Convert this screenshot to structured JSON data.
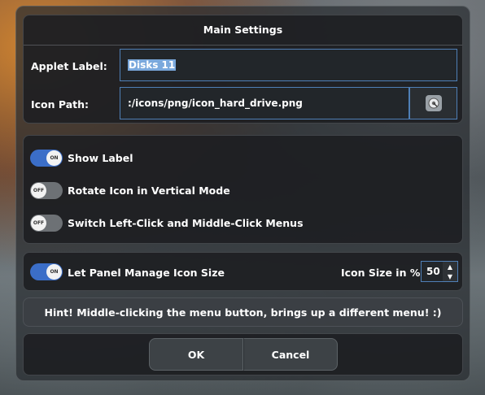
{
  "main_settings": {
    "title": "Main Settings",
    "applet_label_label": "Applet Label:",
    "applet_label_value": "Disks 11",
    "icon_path_label": "Icon Path:",
    "icon_path_value": ":/icons/png/icon_hard_drive.png",
    "icon_button_icon": "disk-icon"
  },
  "toggles": [
    {
      "label": "Show Label",
      "state": "ON"
    },
    {
      "label": "Rotate Icon in Vertical Mode",
      "state": "OFF"
    },
    {
      "label": "Switch Left-Click and Middle-Click Menus",
      "state": "OFF"
    }
  ],
  "icon_size": {
    "manage_label": "Let Panel Manage Icon Size",
    "manage_state": "ON",
    "size_label": "Icon Size in %",
    "size_value": "50"
  },
  "hint": "Hint! Middle-clicking the menu button, brings up a different menu! :)",
  "buttons": {
    "ok": "OK",
    "cancel": "Cancel"
  },
  "colors": {
    "accent": "#4f7fb6",
    "toggle_on": "#3b6ec8",
    "toggle_off": "#6d7175",
    "selection": "#7aa8dc"
  }
}
